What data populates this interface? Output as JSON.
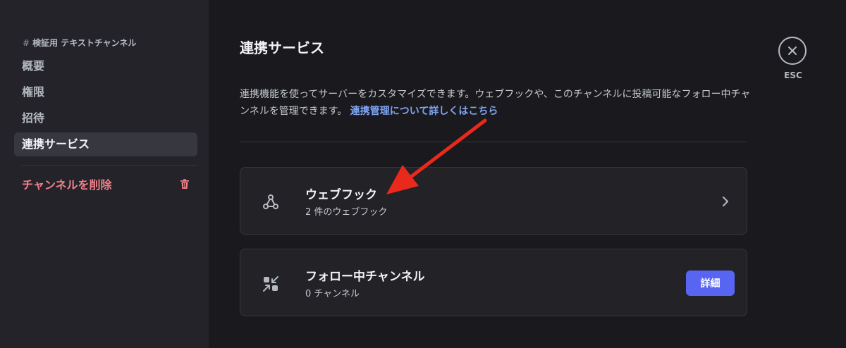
{
  "sidebar": {
    "header_hash": "#",
    "header_label": "検証用 テキストチャンネル",
    "items": [
      {
        "label": "概要"
      },
      {
        "label": "権限"
      },
      {
        "label": "招待"
      },
      {
        "label": "連携サービス"
      }
    ],
    "delete_label": "チャンネルを削除"
  },
  "main": {
    "title": "連携サービス",
    "description": "連携機能を使ってサーバーをカスタマイズできます。ウェブフックや、このチャンネルに投稿可能なフォロー中チャンネルを管理できます。",
    "description_link": "連携管理について詳しくはこちら",
    "cards": [
      {
        "title": "ウェブフック",
        "subtitle": "2 件のウェブフック",
        "icon": "webhook-icon"
      },
      {
        "title": "フォロー中チャンネル",
        "subtitle": "0 チャンネル",
        "icon": "followed-channel-icon",
        "button_label": "詳細"
      }
    ]
  },
  "close": {
    "label": "ESC"
  },
  "colors": {
    "accent": "#5865f2",
    "danger": "#f0808a",
    "link": "#7fa5f5",
    "annotation_arrow": "#e8291c"
  }
}
